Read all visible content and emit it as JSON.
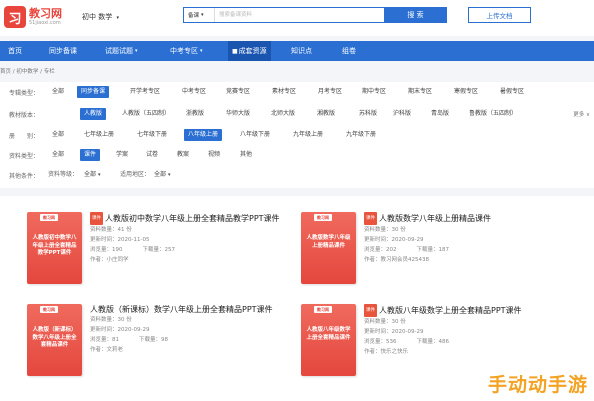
{
  "header": {
    "logo_mark": "习",
    "logo_title": "教习网",
    "logo_sub": "51jiaoxi.com",
    "grade_select": "初中 数学",
    "search_type": "备课",
    "search_placeholder": "搜索备课资料",
    "search_button": "搜 索",
    "upload_button": "上传文档"
  },
  "nav": {
    "items": [
      "首页",
      "同步备课",
      "试题试题",
      "中考专区",
      "成套资源",
      "知识点",
      "组卷"
    ],
    "active_index": 4
  },
  "breadcrumb": {
    "items": [
      "首页",
      "初中数学",
      "专栏"
    ],
    "separator": " / "
  },
  "filters": {
    "rows": [
      {
        "label": "专辑类型：",
        "chips": [
          "全部",
          "同步备课",
          "开学考专区",
          "中考专区",
          "竞赛专区",
          "素材专区",
          "月考专区",
          "期中专区",
          "期末专区",
          "寒假专区",
          "暑假专区"
        ],
        "selected": 1
      },
      {
        "label": "教材版本：",
        "chips": [
          "人教版",
          "人教版（五四制）",
          "浙教版",
          "华师大版",
          "北师大版",
          "湘教版",
          "苏科版",
          "沪科版",
          "青岛版",
          "鲁教版（五四制）"
        ],
        "selected": 0,
        "more": "更多 ∨"
      },
      {
        "label": "册　　别：",
        "chips": [
          "全部",
          "七年级上册",
          "七年级下册",
          "八年级上册",
          "八年级下册",
          "九年级上册",
          "九年级下册"
        ],
        "selected": 3
      },
      {
        "label": "资料类型：",
        "chips": [
          "全部",
          "课件",
          "学案",
          "试卷",
          "教案",
          "视频",
          "其他"
        ],
        "selected": 1
      },
      {
        "label": "其他条件：",
        "sub1_label": "资料等级：",
        "sub1_value": "全部",
        "sub2_label": "适用地区：",
        "sub2_value": "全部"
      }
    ]
  },
  "cards": [
    {
      "badge": "课件",
      "title": "人教版初中数学八年级上册全套精品教学PPT课件",
      "thumb_text": "人教版初中数学八年级上册全套精品教学PPT课件",
      "count": "资料数量：41 份",
      "updated": "更新时间：2020-11-05",
      "views": "浏览量：190",
      "downloads": "下载量：257",
      "author": "作者：小庄同学"
    },
    {
      "badge": "课件",
      "title": "人教版数学八年级上册精品课件",
      "thumb_text": "人教版数学八年级上册精品课件",
      "count": "资料数量：30 份",
      "updated": "更新时间：2020-09-29",
      "views": "浏览量：202",
      "downloads": "下载量：187",
      "author": "作者：教习网会员425438"
    },
    {
      "badge": "课件",
      "title": "人教版（新课标）数学八年级上册全套精品PPT课件",
      "thumb_text": "人教版（新课标）数学八年级上册全套精品课件",
      "count": "资料数量：30 份",
      "updated": "更新时间：2020-09-29",
      "views": "浏览量：81",
      "downloads": "下载量：98",
      "author": "作者：文莉老"
    },
    {
      "badge": "课件",
      "title": "人教版八年级数学上册全套精品PPT课件",
      "thumb_text": "人教版八年级数学上册全套精品课件",
      "count": "资料数量：30 份",
      "updated": "更新时间：2020-09-29",
      "views": "浏览量：536",
      "downloads": "下载量：486",
      "author": "作者：快乐之快乐"
    }
  ],
  "watermark": "手动动手游"
}
